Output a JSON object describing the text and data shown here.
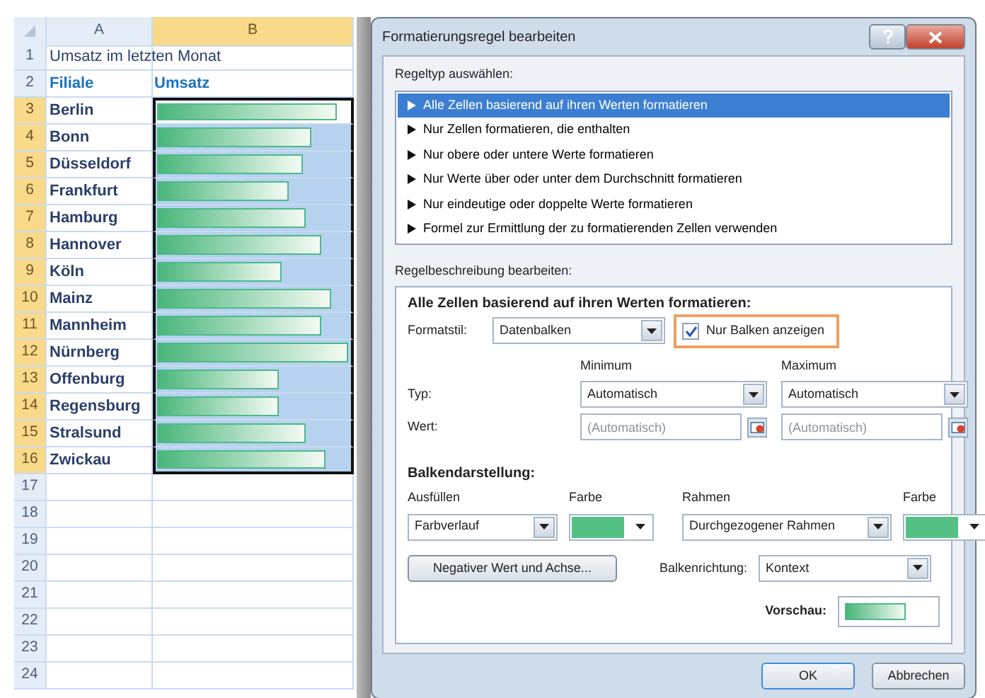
{
  "sheet": {
    "columns": [
      {
        "label": "A",
        "selected": false
      },
      {
        "label": "B",
        "selected": true
      }
    ],
    "rows": [
      {
        "number": "1",
        "selected": false,
        "kind": "title",
        "a": "Umsatz im letzten Monat"
      },
      {
        "number": "2",
        "selected": false,
        "kind": "header",
        "a": "Filiale",
        "b": "Umsatz"
      },
      {
        "number": "3",
        "selected": true,
        "kind": "data",
        "a": "Berlin",
        "level": 0.94,
        "active": true
      },
      {
        "number": "4",
        "selected": true,
        "kind": "data",
        "a": "Bonn",
        "level": 0.81,
        "active": false
      },
      {
        "number": "5",
        "selected": true,
        "kind": "data",
        "a": "Düsseldorf",
        "level": 0.76,
        "active": false
      },
      {
        "number": "6",
        "selected": true,
        "kind": "data",
        "a": "Frankfurt",
        "level": 0.69,
        "active": false
      },
      {
        "number": "7",
        "selected": true,
        "kind": "data",
        "a": "Hamburg",
        "level": 0.78,
        "active": false
      },
      {
        "number": "8",
        "selected": true,
        "kind": "data",
        "a": "Hannover",
        "level": 0.86,
        "active": false
      },
      {
        "number": "9",
        "selected": true,
        "kind": "data",
        "a": "Köln",
        "level": 0.65,
        "active": false
      },
      {
        "number": "10",
        "selected": true,
        "kind": "data",
        "a": "Mainz",
        "level": 0.91,
        "active": false
      },
      {
        "number": "11",
        "selected": true,
        "kind": "data",
        "a": "Mannheim",
        "level": 0.86,
        "active": false
      },
      {
        "number": "12",
        "selected": true,
        "kind": "data",
        "a": "Nürnberg",
        "level": 1.0,
        "active": false
      },
      {
        "number": "13",
        "selected": true,
        "kind": "data",
        "a": "Offenburg",
        "level": 0.64,
        "active": false
      },
      {
        "number": "14",
        "selected": true,
        "kind": "data",
        "a": "Regensburg",
        "level": 0.64,
        "active": false
      },
      {
        "number": "15",
        "selected": true,
        "kind": "data",
        "a": "Stralsund",
        "level": 0.78,
        "active": false
      },
      {
        "number": "16",
        "selected": true,
        "kind": "data",
        "a": "Zwickau",
        "level": 0.88,
        "active": false
      },
      {
        "number": "17",
        "selected": false,
        "kind": "empty"
      },
      {
        "number": "18",
        "selected": false,
        "kind": "empty"
      },
      {
        "number": "19",
        "selected": false,
        "kind": "empty"
      },
      {
        "number": "20",
        "selected": false,
        "kind": "empty"
      },
      {
        "number": "21",
        "selected": false,
        "kind": "empty"
      },
      {
        "number": "22",
        "selected": false,
        "kind": "empty"
      },
      {
        "number": "23",
        "selected": false,
        "kind": "empty"
      },
      {
        "number": "24",
        "selected": false,
        "kind": "empty"
      }
    ]
  },
  "dialog": {
    "title": "Formatierungsregel bearbeiten",
    "rule_type_label": "Regeltyp auswählen:",
    "rule_types": [
      {
        "label": "Alle Zellen basierend auf ihren Werten formatieren",
        "selected": true
      },
      {
        "label": "Nur Zellen formatieren, die enthalten",
        "selected": false
      },
      {
        "label": "Nur obere oder untere Werte formatieren",
        "selected": false
      },
      {
        "label": "Nur Werte über oder unter dem Durchschnitt formatieren",
        "selected": false
      },
      {
        "label": "Nur eindeutige oder doppelte Werte formatieren",
        "selected": false
      },
      {
        "label": "Formel zur Ermittlung der zu formatierenden Zellen verwenden",
        "selected": false
      }
    ],
    "description_label": "Regelbeschreibung bearbeiten:",
    "description_heading": "Alle Zellen basierend auf ihren Werten formatieren:",
    "format_style": {
      "label": "Formatstil:",
      "value": "Datenbalken"
    },
    "bar_only": {
      "label": "Nur Balken anzeigen",
      "checked": true,
      "highlighted": true
    },
    "minimum": {
      "heading": "Minimum",
      "type": "Automatisch",
      "placeholder": "(Automatisch)"
    },
    "maximum": {
      "heading": "Maximum",
      "type": "Automatisch",
      "placeholder": "(Automatisch)"
    },
    "type_label": "Typ:",
    "value_label": "Wert:",
    "appearance_heading": "Balkendarstellung:",
    "fill": {
      "label": "Ausfüllen",
      "value": "Farbverlauf"
    },
    "fill_color": {
      "label": "Farbe",
      "color": "#55c084"
    },
    "border": {
      "label": "Rahmen",
      "value": "Durchgezogener Rahmen"
    },
    "border_color": {
      "label": "Farbe",
      "color": "#55c084"
    },
    "negative_button": "Negativer Wert und Achse...",
    "direction": {
      "label": "Balkenrichtung:",
      "value": "Kontext"
    },
    "preview_label": "Vorschau:",
    "buttons": [
      "OK",
      "Abbrechen"
    ]
  }
}
